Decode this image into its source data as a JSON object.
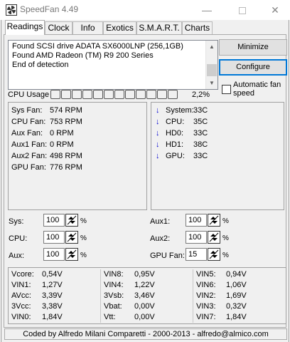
{
  "window": {
    "title": "SpeedFan 4.49"
  },
  "window_controls": {
    "minimize": "—",
    "close": "✕"
  },
  "tabs": [
    {
      "label": "Readings",
      "active": true
    },
    {
      "label": "Clock"
    },
    {
      "label": "Info"
    },
    {
      "label": "Exotics"
    },
    {
      "label": "S.M.A.R.T."
    },
    {
      "label": "Charts"
    }
  ],
  "log_lines": [
    "Found SCSI drive ADATA SX6000LNP (256,1GB)",
    "Found AMD Radeon (TM) R9 200 Series",
    "End of detection"
  ],
  "buttons": {
    "minimize": "Minimize",
    "configure": "Configure"
  },
  "auto_fan_speed": {
    "label": "Automatic fan speed",
    "checked": false
  },
  "cpu_usage": {
    "label": "CPU Usage",
    "cells": 12,
    "percent": "2,2%"
  },
  "fans": [
    {
      "label": "Sys Fan:",
      "value": "574 RPM"
    },
    {
      "label": "CPU Fan:",
      "value": "753 RPM"
    },
    {
      "label": "Aux Fan:",
      "value": "0 RPM"
    },
    {
      "label": "Aux1 Fan:",
      "value": "0 RPM"
    },
    {
      "label": "Aux2 Fan:",
      "value": "498 RPM"
    },
    {
      "label": "GPU Fan:",
      "value": "776 RPM"
    }
  ],
  "temps": [
    {
      "label": "System:",
      "value": "33C"
    },
    {
      "label": "CPU:",
      "value": "35C"
    },
    {
      "label": "HD0:",
      "value": "33C"
    },
    {
      "label": "HD1:",
      "value": "38C"
    },
    {
      "label": "GPU:",
      "value": "33C"
    }
  ],
  "speeds": [
    {
      "label": "Sys:",
      "value": "100",
      "unit": "%"
    },
    {
      "label": "CPU:",
      "value": "100",
      "unit": "%"
    },
    {
      "label": "Aux:",
      "value": "100",
      "unit": "%"
    },
    {
      "label": "Aux1:",
      "value": "100",
      "unit": "%"
    },
    {
      "label": "Aux2:",
      "value": "100",
      "unit": "%"
    },
    {
      "label": "GPU Fan:",
      "value": "15",
      "unit": "%"
    }
  ],
  "voltages": [
    [
      {
        "label": "Vcore:",
        "value": "0,54V"
      },
      {
        "label": "VIN1:",
        "value": "1,27V"
      },
      {
        "label": "AVcc:",
        "value": "3,39V"
      },
      {
        "label": "3Vcc:",
        "value": "3,38V"
      },
      {
        "label": "VIN0:",
        "value": "1,84V"
      }
    ],
    [
      {
        "label": "VIN8:",
        "value": "0,95V"
      },
      {
        "label": "VIN4:",
        "value": "1,22V"
      },
      {
        "label": "3Vsb:",
        "value": "3,46V"
      },
      {
        "label": "Vbat:",
        "value": "0,00V"
      },
      {
        "label": "Vtt:",
        "value": "0,00V"
      }
    ],
    [
      {
        "label": "VIN5:",
        "value": "0,94V"
      },
      {
        "label": "VIN6:",
        "value": "1,06V"
      },
      {
        "label": "VIN2:",
        "value": "1,69V"
      },
      {
        "label": "VIN3:",
        "value": "0,32V"
      },
      {
        "label": "VIN7:",
        "value": "1,84V"
      }
    ]
  ],
  "footer": "Coded by Alfredo Milani Comparetti - 2000-2013 - alfredo@almico.com"
}
